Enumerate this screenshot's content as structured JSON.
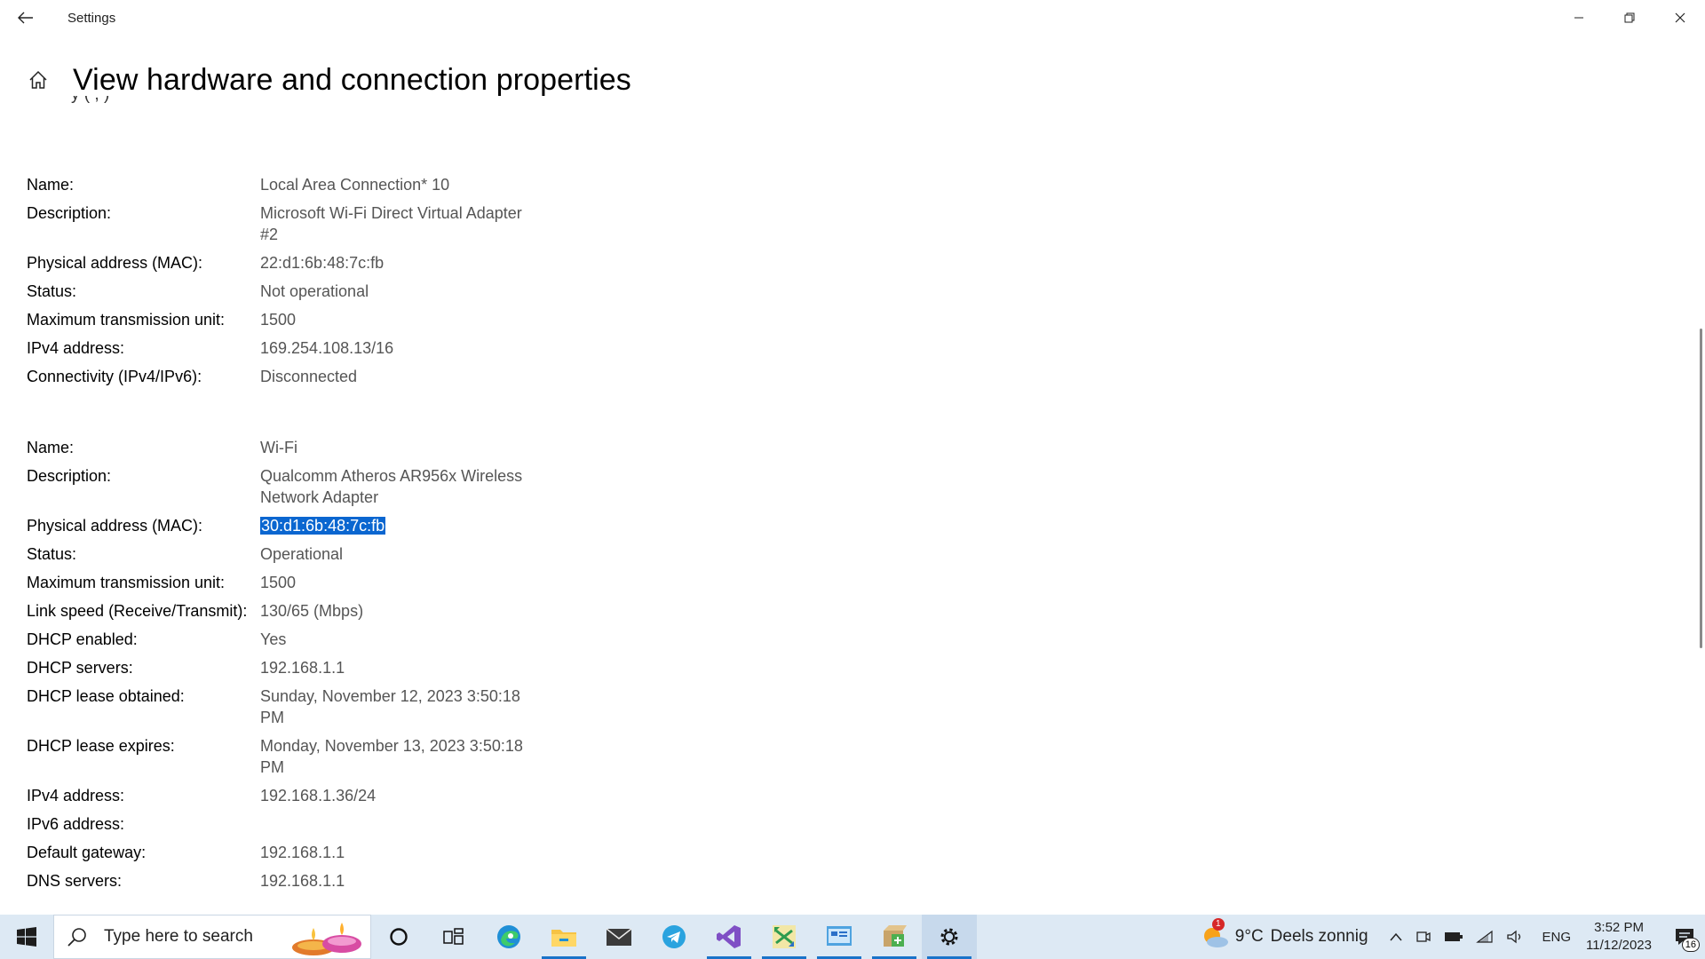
{
  "window": {
    "title": "Settings",
    "controls": {
      "minimize": "—",
      "restore": "❐",
      "close": "✕"
    }
  },
  "page": {
    "title": "View hardware and connection properties",
    "clipped_text": "y (   ,   )"
  },
  "adapters": [
    {
      "rows": [
        {
          "label": "Name:",
          "value": "Local Area Connection* 10"
        },
        {
          "label": "Description:",
          "value": "Microsoft Wi-Fi Direct Virtual Adapter #2"
        },
        {
          "label": "Physical address (MAC):",
          "value": "22:d1:6b:48:7c:fb"
        },
        {
          "label": "Status:",
          "value": "Not operational"
        },
        {
          "label": "Maximum transmission unit:",
          "value": "1500"
        },
        {
          "label": "IPv4 address:",
          "value": "169.254.108.13/16"
        },
        {
          "label": "Connectivity (IPv4/IPv6):",
          "value": "Disconnected"
        }
      ]
    },
    {
      "rows": [
        {
          "label": "Name:",
          "value": "Wi-Fi"
        },
        {
          "label": "Description:",
          "value": "Qualcomm Atheros AR956x Wireless Network Adapter"
        },
        {
          "label": "Physical address (MAC):",
          "value": "30:d1:6b:48:7c:fb",
          "selected": true
        },
        {
          "label": "Status:",
          "value": "Operational"
        },
        {
          "label": "Maximum transmission unit:",
          "value": "1500"
        },
        {
          "label": "Link speed (Receive/Transmit):",
          "value": "130/65 (Mbps)"
        },
        {
          "label": "DHCP enabled:",
          "value": "Yes"
        },
        {
          "label": "DHCP servers:",
          "value": "192.168.1.1"
        },
        {
          "label": "DHCP lease obtained:",
          "value": "Sunday, November 12, 2023 3:50:18 PM"
        },
        {
          "label": "DHCP lease expires:",
          "value": "Monday, November 13, 2023 3:50:18 PM"
        },
        {
          "label": "IPv4 address:",
          "value": "192.168.1.36/24"
        },
        {
          "label": "IPv6 address:",
          "value": ""
        },
        {
          "label": "Default gateway:",
          "value": "192.168.1.1"
        },
        {
          "label": "DNS servers:",
          "value": "192.168.1.1"
        }
      ]
    }
  ],
  "taskbar": {
    "search_placeholder": "Type here to search",
    "apps": [
      "cortana-icon",
      "task-view-icon",
      "edge-icon",
      "file-explorer-icon",
      "mail-icon",
      "telegram-icon",
      "visual-studio-icon",
      "network-tool-icon",
      "control-panel-icon",
      "installer-icon",
      "settings-icon"
    ],
    "weather": {
      "temp": "9°C",
      "desc": "Deels zonnig",
      "badge": "1"
    },
    "language": "ENG",
    "time": "3:52 PM",
    "date": "11/12/2023",
    "notifications": "16"
  },
  "colors": {
    "selection": "#0a66d0",
    "taskbar": "#dde9f4",
    "value_text": "#555555"
  }
}
